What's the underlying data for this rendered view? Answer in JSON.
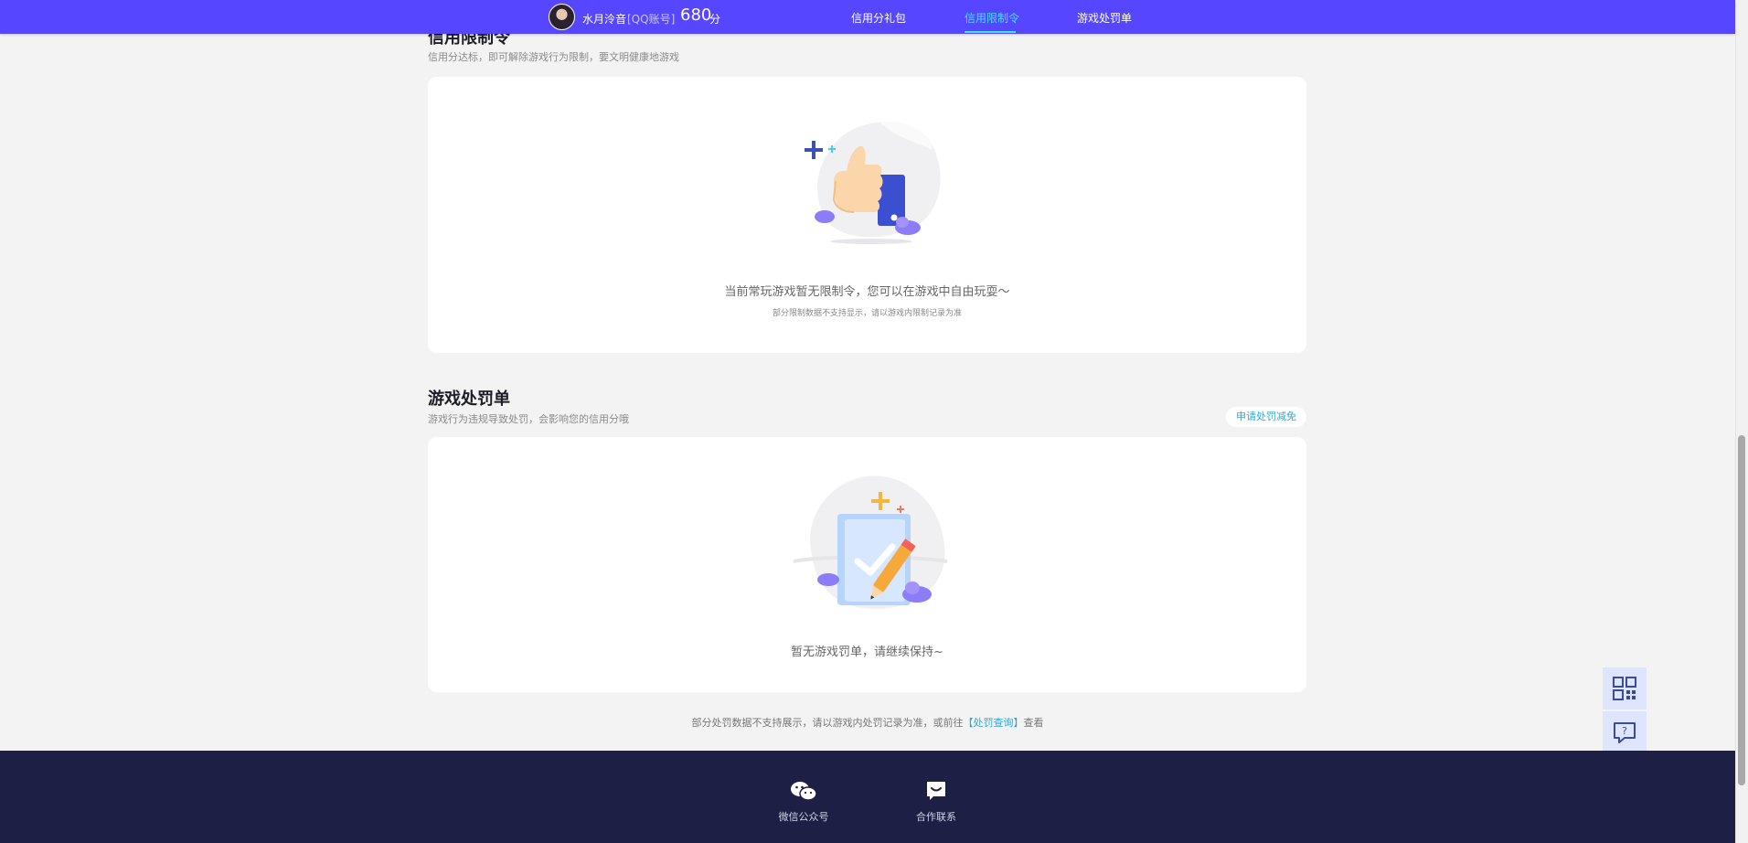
{
  "header": {
    "username": "水月泠音",
    "account_label": "[QQ账号]",
    "score": "680",
    "score_unit": "分",
    "tabs": [
      {
        "label": "信用分礼包",
        "active": false
      },
      {
        "label": "信用限制令",
        "active": true
      },
      {
        "label": "游戏处罚单",
        "active": false
      }
    ],
    "accent_color": "#5746ff",
    "active_tab_color": "#3fe0ff"
  },
  "restriction_section": {
    "title": "信用限制令",
    "subtitle": "信用分达标，即可解除游戏行为限制，要文明健康地游戏",
    "empty_icon": "thumbs-up-illustration",
    "empty_text": "当前常玩游戏暂无限制令，您可以在游戏中自由玩耍～",
    "empty_subtext": "部分限制数据不支持显示，请以游戏内限制记录为准"
  },
  "penalty_section": {
    "title": "游戏处罚单",
    "subtitle": "游戏行为违规导致处罚，会影响您的信用分哦",
    "apply_button": "申请处罚减免",
    "empty_icon": "document-pencil-illustration",
    "empty_text": "暂无游戏罚单，请继续保持~"
  },
  "note": {
    "text_before": "部分处罚数据不支持展示，请以游戏内处罚记录为准，或前往",
    "link": "【处罚查询】",
    "text_after": "查看"
  },
  "side_buttons": [
    {
      "icon": "qr-code-icon"
    },
    {
      "icon": "help-chat-icon"
    }
  ],
  "footer": {
    "items": [
      {
        "label": "微信公众号",
        "icon": "wechat-icon"
      },
      {
        "label": "合作联系",
        "icon": "chat-smile-icon"
      }
    ]
  }
}
